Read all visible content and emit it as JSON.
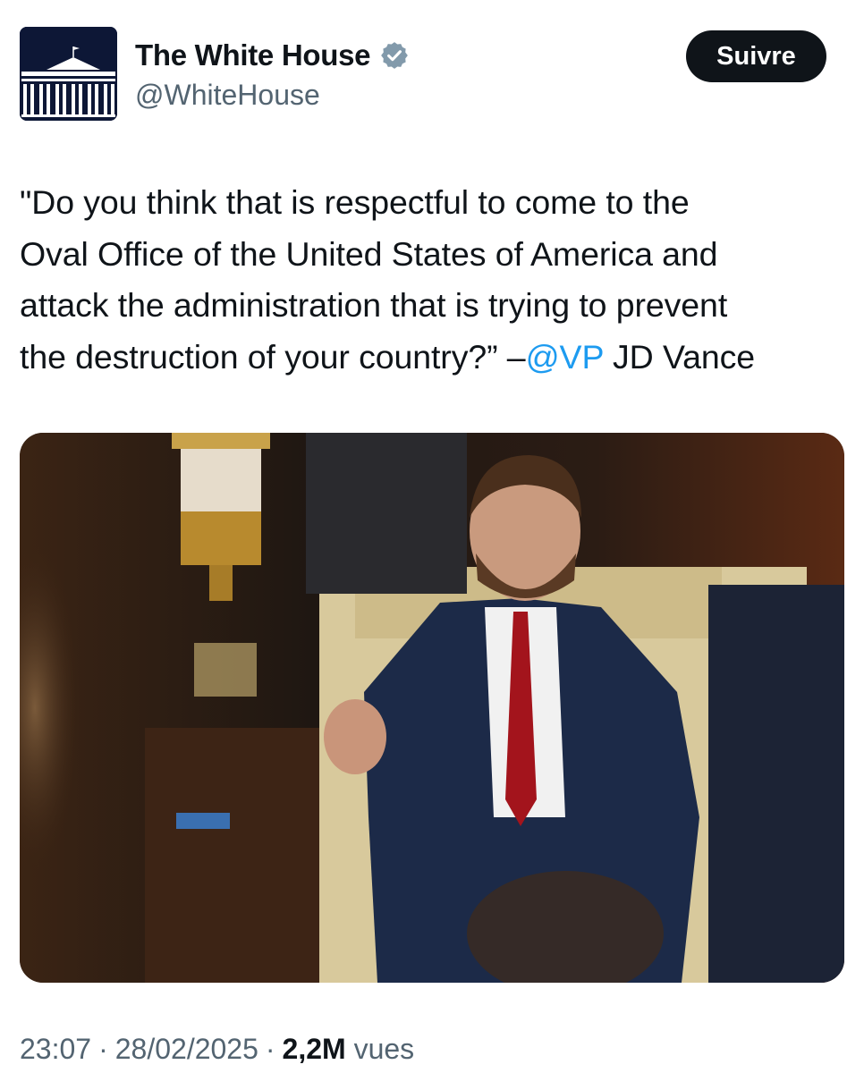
{
  "account": {
    "display_name": "The White House",
    "handle": "@WhiteHouse",
    "verified_icon": "verified-badge-icon"
  },
  "actions": {
    "follow_label": "Suivre"
  },
  "tweet": {
    "text_before_mention": "\"Do you think that is respectful to come to the\nOval Office of the United States of America and\nattack the administration that is trying to prevent\nthe destruction of your country?” –",
    "mention": "@VP",
    "text_after_mention": " JD Vance",
    "image_icon": "photo"
  },
  "meta": {
    "time": "23:07",
    "separator": "·",
    "date": "28/02/2025",
    "views_count": "2,2M",
    "views_label": "vues"
  },
  "colors": {
    "text": "#0f1419",
    "secondary": "#536471",
    "link": "#1d9bf0",
    "button_bg": "#0f1419"
  }
}
